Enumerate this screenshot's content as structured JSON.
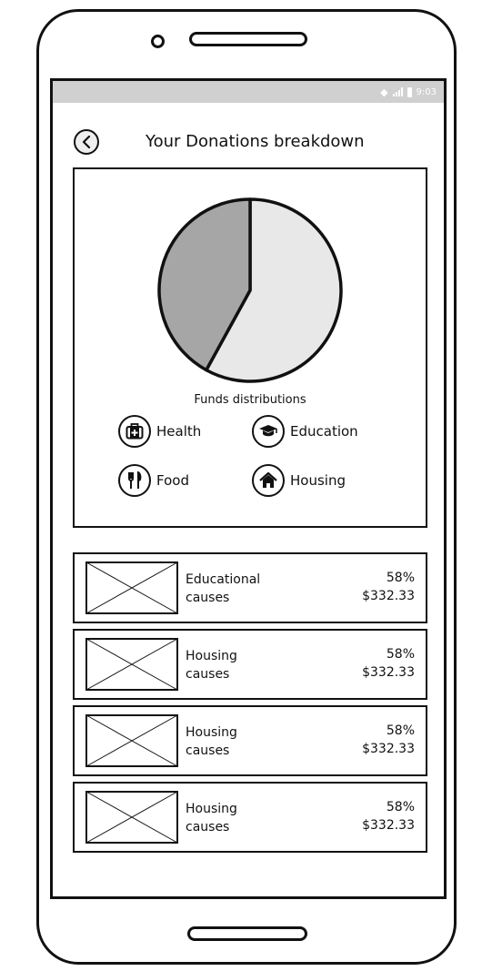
{
  "status_bar": {
    "time": "9:03"
  },
  "header": {
    "title": "Your Donations breakdown",
    "back_icon": "chevron-left-icon"
  },
  "chart": {
    "label": "Funds distributions"
  },
  "chart_data": {
    "type": "pie",
    "values": [
      58,
      42
    ],
    "colors": [
      "#e8e8e8",
      "#a6a6a6"
    ]
  },
  "legend": [
    {
      "label": "Health",
      "icon": "first-aid-kit-icon"
    },
    {
      "label": "Education",
      "icon": "graduation-cap-icon"
    },
    {
      "label": "Food",
      "icon": "fork-knife-icon"
    },
    {
      "label": "Housing",
      "icon": "home-icon"
    }
  ],
  "causes": [
    {
      "line1": "Educational",
      "line2": "causes",
      "percent": "58%",
      "amount": "$332.33"
    },
    {
      "line1": "Housing",
      "line2": "causes",
      "percent": "58%",
      "amount": "$332.33"
    },
    {
      "line1": "Housing",
      "line2": "causes",
      "percent": "58%",
      "amount": "$332.33"
    },
    {
      "line1": "Housing",
      "line2": "causes",
      "percent": "58%",
      "amount": "$332.33"
    }
  ]
}
